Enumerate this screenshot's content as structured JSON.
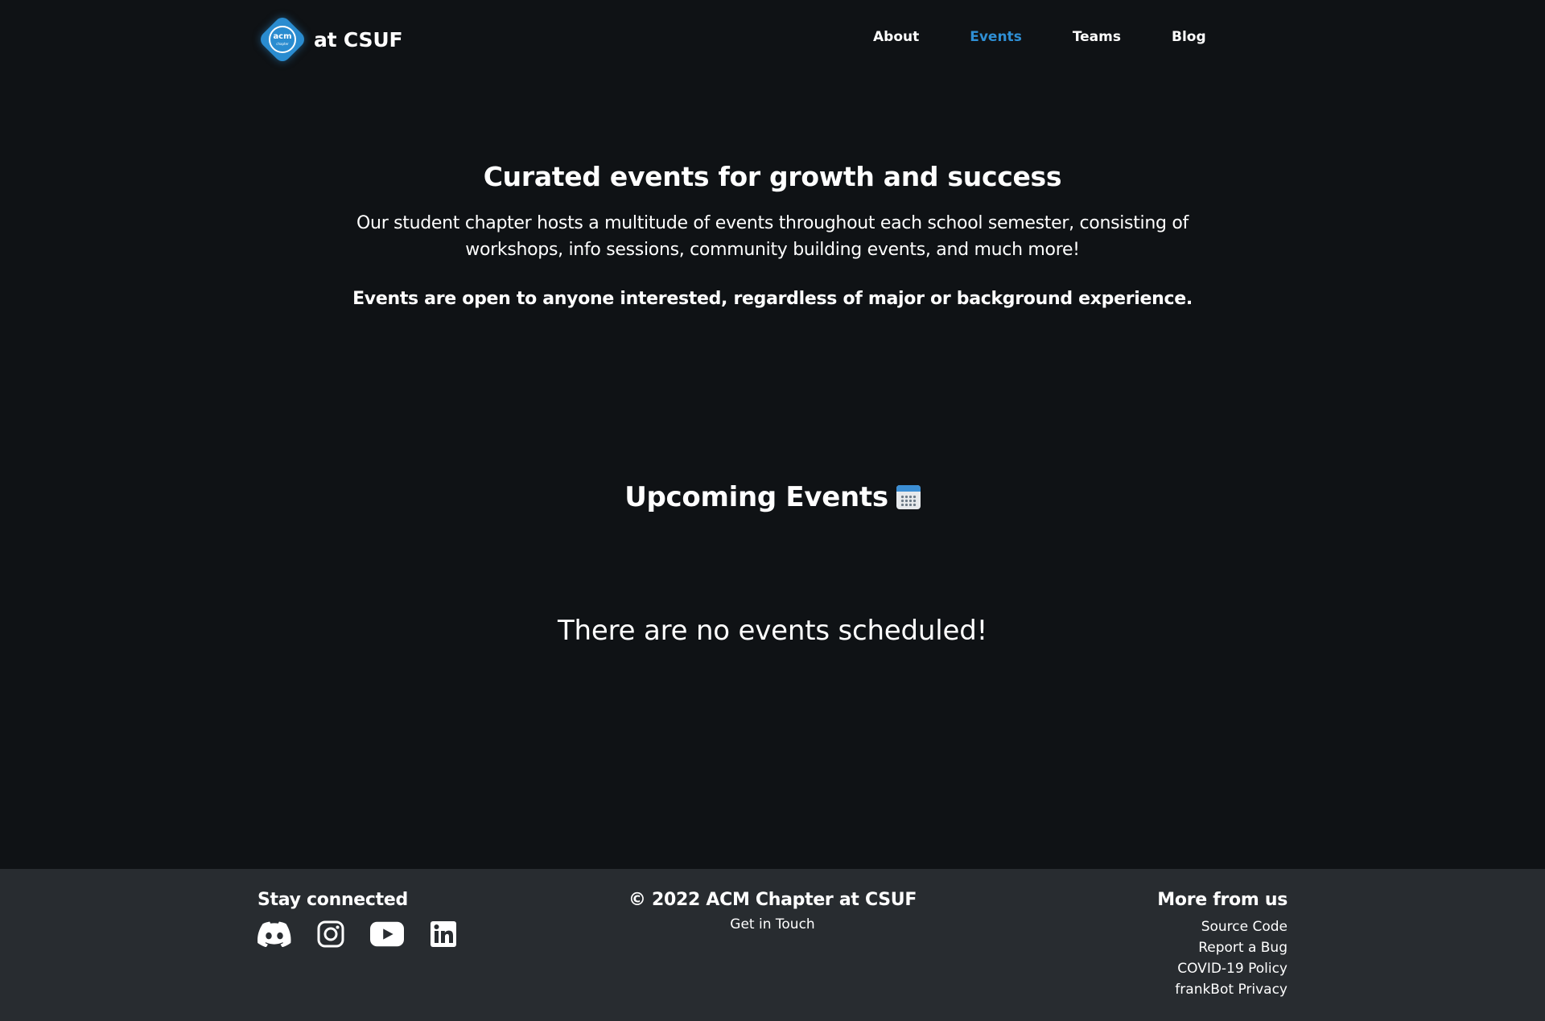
{
  "header": {
    "logo_text": "acm",
    "logo_subtext": "chapter",
    "brand_name": "at CSUF",
    "nav": [
      {
        "label": "About",
        "active": false
      },
      {
        "label": "Events",
        "active": true
      },
      {
        "label": "Teams",
        "active": false
      },
      {
        "label": "Blog",
        "active": false
      }
    ]
  },
  "hero": {
    "title": "Curated events for growth and success",
    "lead": "Our student chapter hosts a multitude of events throughout each school semester, consisting of workshops, info sessions, community building events, and much more!",
    "open_note": "Events are open to anyone interested, regardless of major or background experience."
  },
  "upcoming": {
    "title": "Upcoming Events",
    "icon": "calendar-icon",
    "empty_message": "There are no events scheduled!"
  },
  "footer": {
    "stay_connected": "Stay connected",
    "socials": [
      "discord-icon",
      "instagram-icon",
      "youtube-icon",
      "linkedin-icon"
    ],
    "copyright": "© 2022 ACM Chapter at CSUF",
    "get_in_touch": "Get in Touch",
    "more_title": "More from us",
    "links": [
      "Source Code",
      "Report a Bug",
      "COVID-19 Policy",
      "frankBot Privacy"
    ]
  },
  "colors": {
    "background": "#0f1215",
    "footer_background": "#282c30",
    "accent": "#2f8fd4",
    "text": "#ffffff"
  }
}
